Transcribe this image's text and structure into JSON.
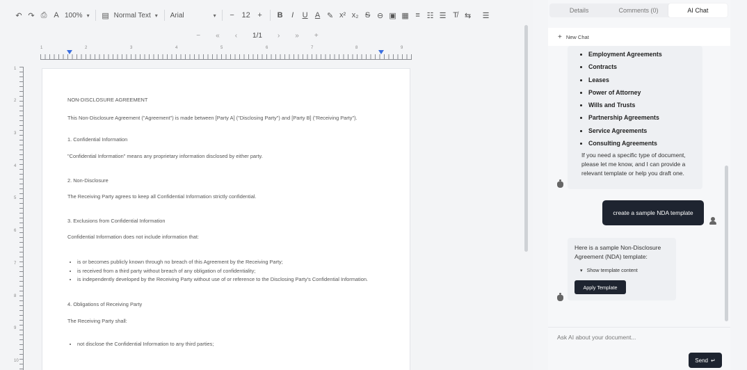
{
  "toolbar": {
    "zoom": "100%",
    "style_select": "Normal Text",
    "font_select": "Arial",
    "font_size": "12",
    "buttons": {
      "undo": "↶",
      "redo": "↷",
      "print": "⎙",
      "spellcheck": "A",
      "minus": "−",
      "plus": "+",
      "bold": "B",
      "italic": "I",
      "underline": "U",
      "text_color": "A",
      "highlight": "✎",
      "superscript": "x²",
      "subscript": "x₂",
      "strikethrough": "S",
      "link": "⊖",
      "image": "▣",
      "table": "▦",
      "align": "≡",
      "numbered_list": "☷",
      "bulleted_list": "☰",
      "clear_format": "T̸",
      "rtl": "⇆",
      "more": "☰"
    }
  },
  "pager": {
    "first": "«",
    "prev": "‹",
    "page": "1/1",
    "next": "›",
    "last": "»",
    "add": "+"
  },
  "ruler": {
    "numbers": [
      "1",
      "2",
      "3",
      "4",
      "5",
      "6",
      "7",
      "8",
      "9"
    ]
  },
  "vruler": {
    "numbers": [
      "1",
      "2",
      "3",
      "4",
      "5",
      "6",
      "7",
      "8",
      "9",
      "10"
    ]
  },
  "document": {
    "title": "NON-DISCLOSURE AGREEMENT",
    "intro": "This Non-Disclosure Agreement (\"Agreement\") is made between [Party A] (\"Disclosing Party\") and [Party B] (\"Receiving Party\").",
    "s1_heading": "1. Confidential Information",
    "s1_body": "\"Confidential Information\" means any proprietary information disclosed by either party.",
    "s2_heading": "2. Non-Disclosure",
    "s2_body": "The Receiving Party agrees to keep all Confidential Information strictly confidential.",
    "s3_heading": "3. Exclusions from Confidential Information",
    "s3_body": "Confidential Information does not include information that:",
    "s3_items": [
      "is or becomes publicly known through no breach of this Agreement by the Receiving Party;",
      "is received from a third party without breach of any obligation of confidentiality;",
      "is independently developed by the Receiving Party without use of or reference to the Disclosing Party's Confidential Information."
    ],
    "s4_heading": "4. Obligations of Receiving Party",
    "s4_body": "The Receiving Party shall:",
    "s4_items": [
      "not disclose the Confidential Information to any third parties;"
    ]
  },
  "panel": {
    "tabs": [
      "Details",
      "Comments (0)",
      "AI Chat"
    ],
    "new_chat": "New Chat",
    "doc_types": [
      "Employment Agreements",
      "Contracts",
      "Leases",
      "Power of Attorney",
      "Wills and Trusts",
      "Partnership Agreements",
      "Service Agreements",
      "Consulting Agreements"
    ],
    "bot_followup": "If you need a specific type of document, please let me know, and I can provide a relevant template or help you draft one.",
    "user_message": "create a sample NDA template",
    "bot_reply": "Here is a sample Non-Disclosure Agreement (NDA) template:",
    "show_content": "Show template content",
    "apply_button": "Apply Template",
    "input_placeholder": "Ask AI about your document...",
    "send_button": "Send",
    "send_icon": "↵"
  }
}
